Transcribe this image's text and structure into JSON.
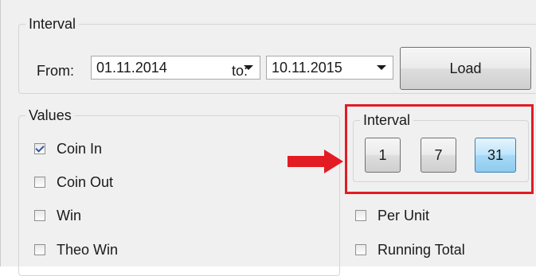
{
  "interval_group": {
    "legend": "Interval",
    "from_label": "From:",
    "from_value": "01.11.2014",
    "to_label": "to:",
    "to_value": "10.11.2015",
    "load_button": "Load"
  },
  "values_group": {
    "legend": "Values",
    "items": [
      {
        "label": "Coin In",
        "checked": true
      },
      {
        "label": "Coin Out",
        "checked": false
      },
      {
        "label": "Win",
        "checked": false
      },
      {
        "label": "Theo Win",
        "checked": false
      }
    ]
  },
  "interval_days_group": {
    "legend": "Interval",
    "buttons": [
      {
        "label": "1",
        "active": false
      },
      {
        "label": "7",
        "active": false
      },
      {
        "label": "31",
        "active": true
      }
    ]
  },
  "options": {
    "per_unit": {
      "label": "Per Unit",
      "checked": false
    },
    "running_total": {
      "label": "Running Total",
      "checked": false
    }
  },
  "annotation": {
    "color": "#e31b23",
    "arrow_icon": "right-arrow-icon"
  }
}
